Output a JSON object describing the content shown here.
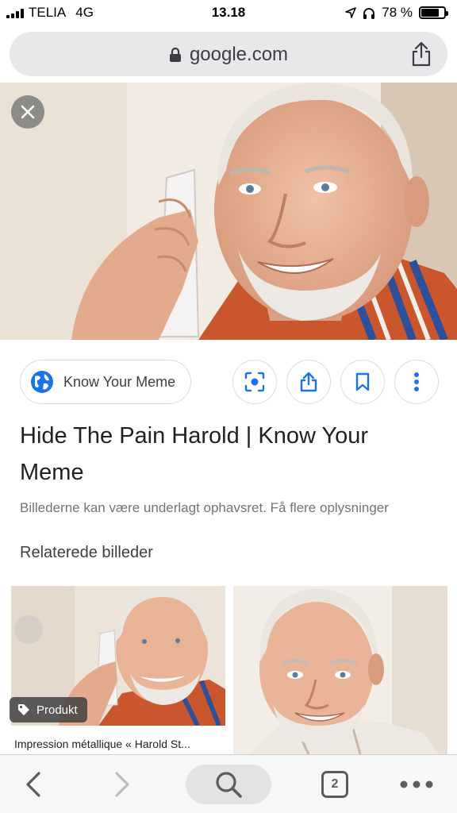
{
  "status_bar": {
    "carrier": "TELIA",
    "network": "4G",
    "time": "13.18",
    "battery_percent": "78 %",
    "battery_level": 0.78
  },
  "address_bar": {
    "url": "google.com",
    "icons": [
      "lock-icon",
      "share-icon"
    ]
  },
  "image_viewer": {
    "close_icon": "close-icon",
    "source_chip": {
      "label": "Know Your Meme",
      "icon": "globe-icon"
    },
    "actions": [
      "lens-icon",
      "share-icon",
      "bookmark-icon",
      "more-vertical-icon"
    ],
    "title": "Hide The Pain Harold | Know Your Meme",
    "copyright_notice": "Billederne kan være underlagt ophavsret. Få flere oplysninger",
    "related_heading": "Relaterede billeder",
    "related": [
      {
        "badge": "Produkt",
        "caption": "Impression métallique « Harold St..."
      },
      {
        "badge": "",
        "caption": ""
      }
    ]
  },
  "toolbar": {
    "tab_count": "2",
    "icons": [
      "back-icon",
      "forward-icon",
      "search-icon",
      "tabs-icon",
      "more-horizontal-icon"
    ]
  },
  "colors": {
    "accent_blue": "#1a73e8",
    "chip_border": "#dadce0",
    "toolbar_bg": "#f7f7f7"
  }
}
